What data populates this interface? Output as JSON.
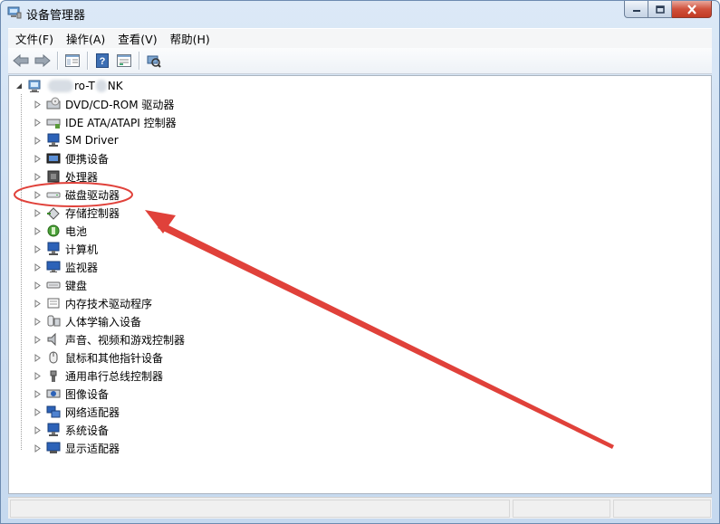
{
  "window": {
    "title": "设备管理器",
    "icon": "device-manager-icon"
  },
  "menubar": {
    "items": [
      {
        "label": "文件(F)"
      },
      {
        "label": "操作(A)"
      },
      {
        "label": "查看(V)"
      },
      {
        "label": "帮助(H)"
      }
    ]
  },
  "toolbar": {
    "buttons": [
      "back-arrow-icon",
      "forward-arrow-icon",
      "properties-icon",
      "help-icon",
      "update-driver-icon",
      "scan-hardware-icon"
    ]
  },
  "tree": {
    "root": {
      "label_visible": "ro-T",
      "label_suffix": "NK"
    },
    "items": [
      {
        "label": "DVD/CD-ROM 驱动器",
        "icon": "dvd-drive-icon"
      },
      {
        "label": "IDE ATA/ATAPI 控制器",
        "icon": "ide-controller-icon"
      },
      {
        "label": "SM Driver",
        "icon": "sm-driver-icon"
      },
      {
        "label": "便携设备",
        "icon": "portable-device-icon"
      },
      {
        "label": "处理器",
        "icon": "processor-icon"
      },
      {
        "label": "磁盘驱动器",
        "icon": "disk-drive-icon"
      },
      {
        "label": "存储控制器",
        "icon": "storage-controller-icon"
      },
      {
        "label": "电池",
        "icon": "battery-icon"
      },
      {
        "label": "计算机",
        "icon": "computer-icon"
      },
      {
        "label": "监视器",
        "icon": "monitor-icon"
      },
      {
        "label": "键盘",
        "icon": "keyboard-icon"
      },
      {
        "label": "内存技术驱动程序",
        "icon": "memory-tech-icon"
      },
      {
        "label": "人体学输入设备",
        "icon": "hid-icon"
      },
      {
        "label": "声音、视频和游戏控制器",
        "icon": "sound-icon"
      },
      {
        "label": "鼠标和其他指针设备",
        "icon": "mouse-icon"
      },
      {
        "label": "通用串行总线控制器",
        "icon": "usb-icon"
      },
      {
        "label": "图像设备",
        "icon": "imaging-device-icon"
      },
      {
        "label": "网络适配器",
        "icon": "network-adapter-icon"
      },
      {
        "label": "系统设备",
        "icon": "system-device-icon"
      },
      {
        "label": "显示适配器",
        "icon": "display-adapter-icon"
      }
    ]
  },
  "annotation": {
    "color": "#e0413a",
    "highlighted_item": "磁盘驱动器"
  }
}
